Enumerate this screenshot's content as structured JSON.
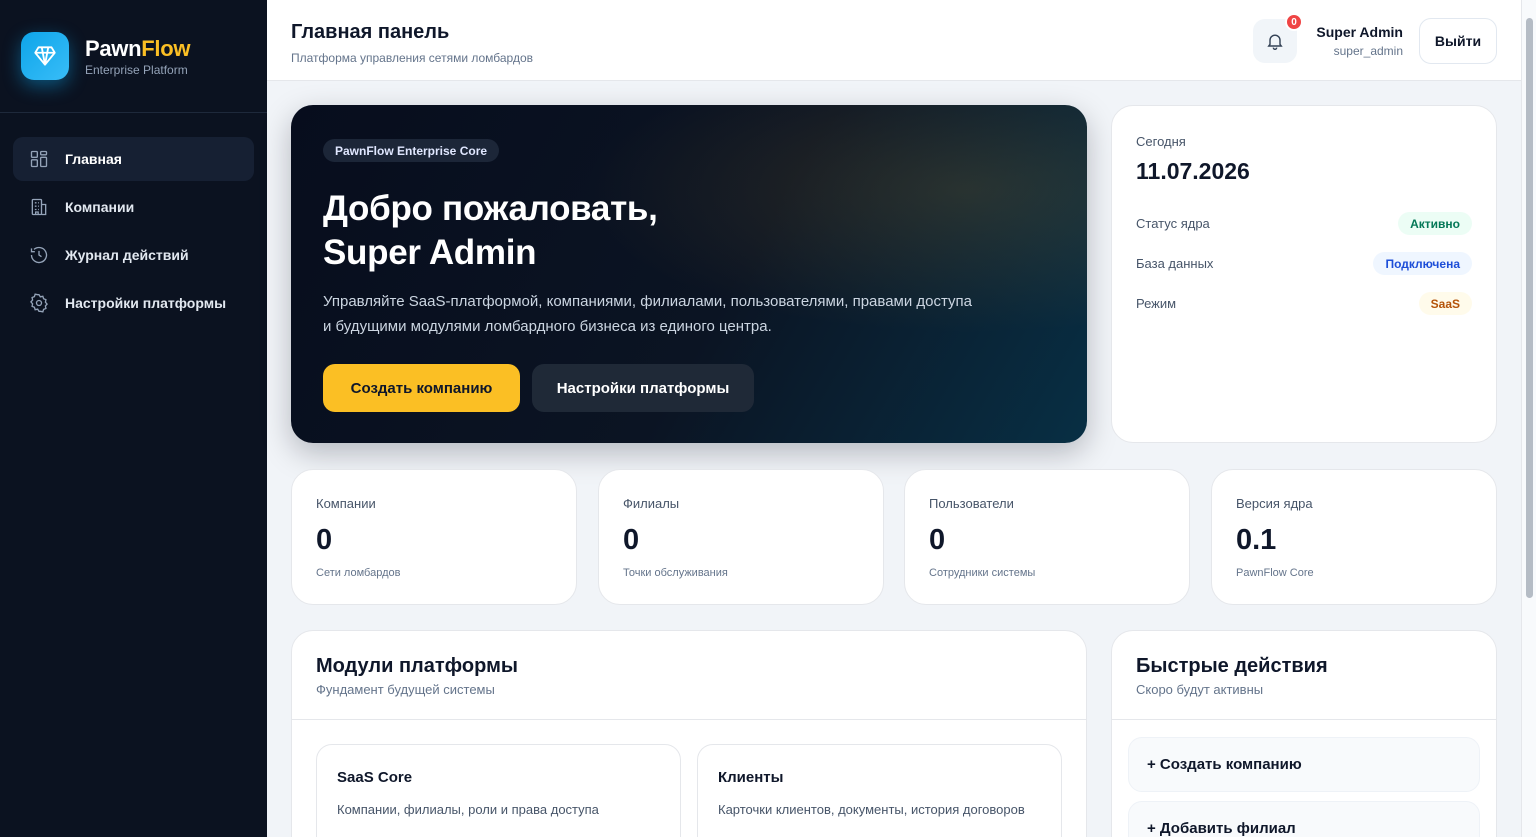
{
  "brand": {
    "name_part1": "Pawn",
    "name_part2": "Flow",
    "subtitle": "Enterprise Platform",
    "logo_icon": "diamond-icon"
  },
  "sidebar": {
    "items": [
      {
        "label": "Главная",
        "icon": "dashboard-grid-icon",
        "active": true
      },
      {
        "label": "Компании",
        "icon": "building-icon",
        "active": false
      },
      {
        "label": "Журнал действий",
        "icon": "history-icon",
        "active": false
      },
      {
        "label": "Настройки платформы",
        "icon": "gear-icon",
        "active": false
      }
    ]
  },
  "header": {
    "title": "Главная панель",
    "subtitle": "Платформа управления сетями ломбардов",
    "notifications_count": "0",
    "user_name": "Super Admin",
    "user_login": "super_admin",
    "logout_label": "Выйти"
  },
  "hero": {
    "chip": "PawnFlow Enterprise Core",
    "title_line1": "Добро пожаловать,",
    "title_line2": "Super Admin",
    "text": "Управляйте SaaS-платформой, компаниями, филиалами, пользователями, правами доступа и будущими модулями ломбардного бизнеса из единого центра.",
    "primary_button": "Создать компанию",
    "secondary_button": "Настройки платформы"
  },
  "today": {
    "label": "Сегодня",
    "date": "11.07.2026",
    "rows": [
      {
        "label": "Статус ядра",
        "value": "Активно",
        "color": "#047857"
      },
      {
        "label": "База данных",
        "value": "Подключена",
        "color": "#1d4ed8"
      },
      {
        "label": "Режим",
        "value": "SaaS",
        "color": "#b45309"
      }
    ]
  },
  "stats": [
    {
      "label": "Компании",
      "value": "0",
      "hint": "Сети ломбардов"
    },
    {
      "label": "Филиалы",
      "value": "0",
      "hint": "Точки обслуживания"
    },
    {
      "label": "Пользователи",
      "value": "0",
      "hint": "Сотрудники системы"
    },
    {
      "label": "Версия ядра",
      "value": "0.1",
      "hint": "PawnFlow Core"
    }
  ],
  "modules": {
    "title": "Модули платформы",
    "subtitle": "Фундамент будущей системы",
    "items": [
      {
        "title": "SaaS Core",
        "description": "Компании, филиалы, роли и права доступа"
      },
      {
        "title": "Клиенты",
        "description": "Карточки клиентов, документы, история договоров"
      }
    ]
  },
  "quick_actions": {
    "title": "Быстрые действия",
    "subtitle": "Скоро будут активны",
    "items": [
      "+ Создать компанию",
      "+ Добавить филиал"
    ]
  },
  "colors": {
    "sidebar_bg": "#0b1220",
    "accent_yellow": "#fbbf24",
    "logo_blue": "#0ea5e9"
  }
}
